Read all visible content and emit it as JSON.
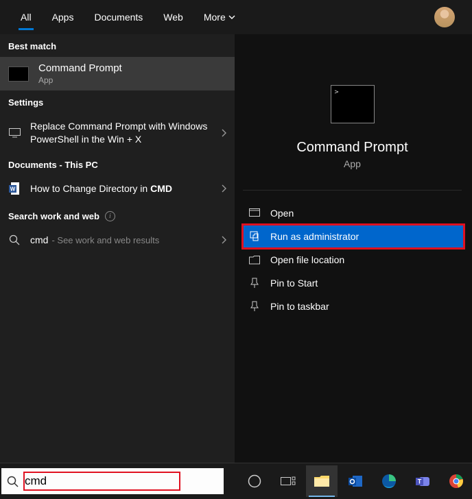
{
  "tabs": {
    "all": "All",
    "apps": "Apps",
    "documents": "Documents",
    "web": "Web",
    "more": "More"
  },
  "left": {
    "best_match_header": "Best match",
    "best_match": {
      "title": "Command Prompt",
      "sub": "App"
    },
    "settings_header": "Settings",
    "setting_item": "Replace Command Prompt with Windows PowerShell in the Win + X",
    "documents_header": "Documents - This PC",
    "doc_item_prefix": "How to Change Directory in ",
    "doc_item_bold": "CMD",
    "search_work_web": "Search work and web",
    "web_query": "cmd",
    "web_sub": "- See work and web results"
  },
  "right": {
    "preview_title": "Command Prompt",
    "preview_sub": "App",
    "actions": {
      "open": "Open",
      "run_admin": "Run as administrator",
      "open_loc": "Open file location",
      "pin_start": "Pin to Start",
      "pin_taskbar": "Pin to taskbar"
    }
  },
  "taskbar": {
    "search_value": "cmd"
  }
}
